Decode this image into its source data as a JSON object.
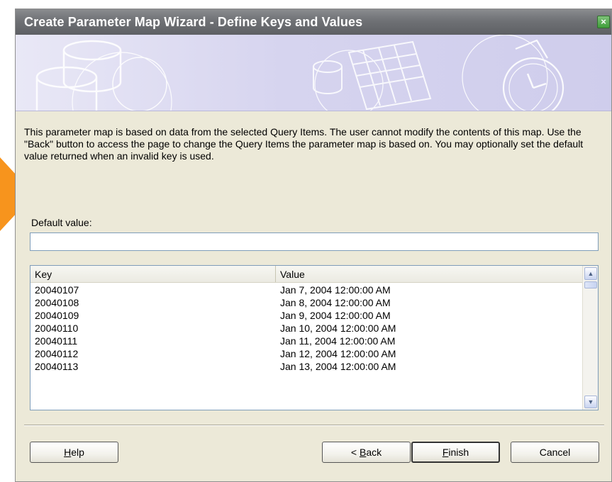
{
  "window": {
    "title": "Create Parameter Map Wizard - Define Keys and Values",
    "close_label": "×"
  },
  "description": "This parameter map is based on data from the selected Query Items.  The user cannot modify the contents of this map.  Use the \"Back\" button to access the page to change the Query Items the parameter map is based on.  You may optionally set the default value returned when an invalid key is used.",
  "default_value": {
    "label": "Default value:",
    "value": ""
  },
  "table": {
    "columns": [
      "Key",
      "Value"
    ],
    "rows": [
      {
        "key": "20040107",
        "value": "Jan 7, 2004 12:00:00 AM"
      },
      {
        "key": "20040108",
        "value": "Jan 8, 2004 12:00:00 AM"
      },
      {
        "key": "20040109",
        "value": "Jan 9, 2004 12:00:00 AM"
      },
      {
        "key": "20040110",
        "value": "Jan 10, 2004 12:00:00 AM"
      },
      {
        "key": "20040111",
        "value": "Jan 11, 2004 12:00:00 AM"
      },
      {
        "key": "20040112",
        "value": "Jan 12, 2004 12:00:00 AM"
      },
      {
        "key": "20040113",
        "value": "Jan 13, 2004 12:00:00 AM"
      }
    ]
  },
  "buttons": {
    "help": {
      "mnemonic": "H",
      "rest": "elp"
    },
    "back": {
      "prefix": "< ",
      "mnemonic": "B",
      "rest": "ack"
    },
    "finish": {
      "mnemonic": "F",
      "rest": "inish"
    },
    "cancel": {
      "label": "Cancel"
    }
  },
  "icons": {
    "close": "close-icon",
    "scroll_up": "scroll-up-arrow-icon",
    "scroll_down": "scroll-down-arrow-icon",
    "callout": "callout-arrow-icon"
  },
  "colors": {
    "titlebar": "#6f7175",
    "banner": "#d6d4ef",
    "dialog_bg": "#ece9d8",
    "callout": "#f7941d"
  }
}
